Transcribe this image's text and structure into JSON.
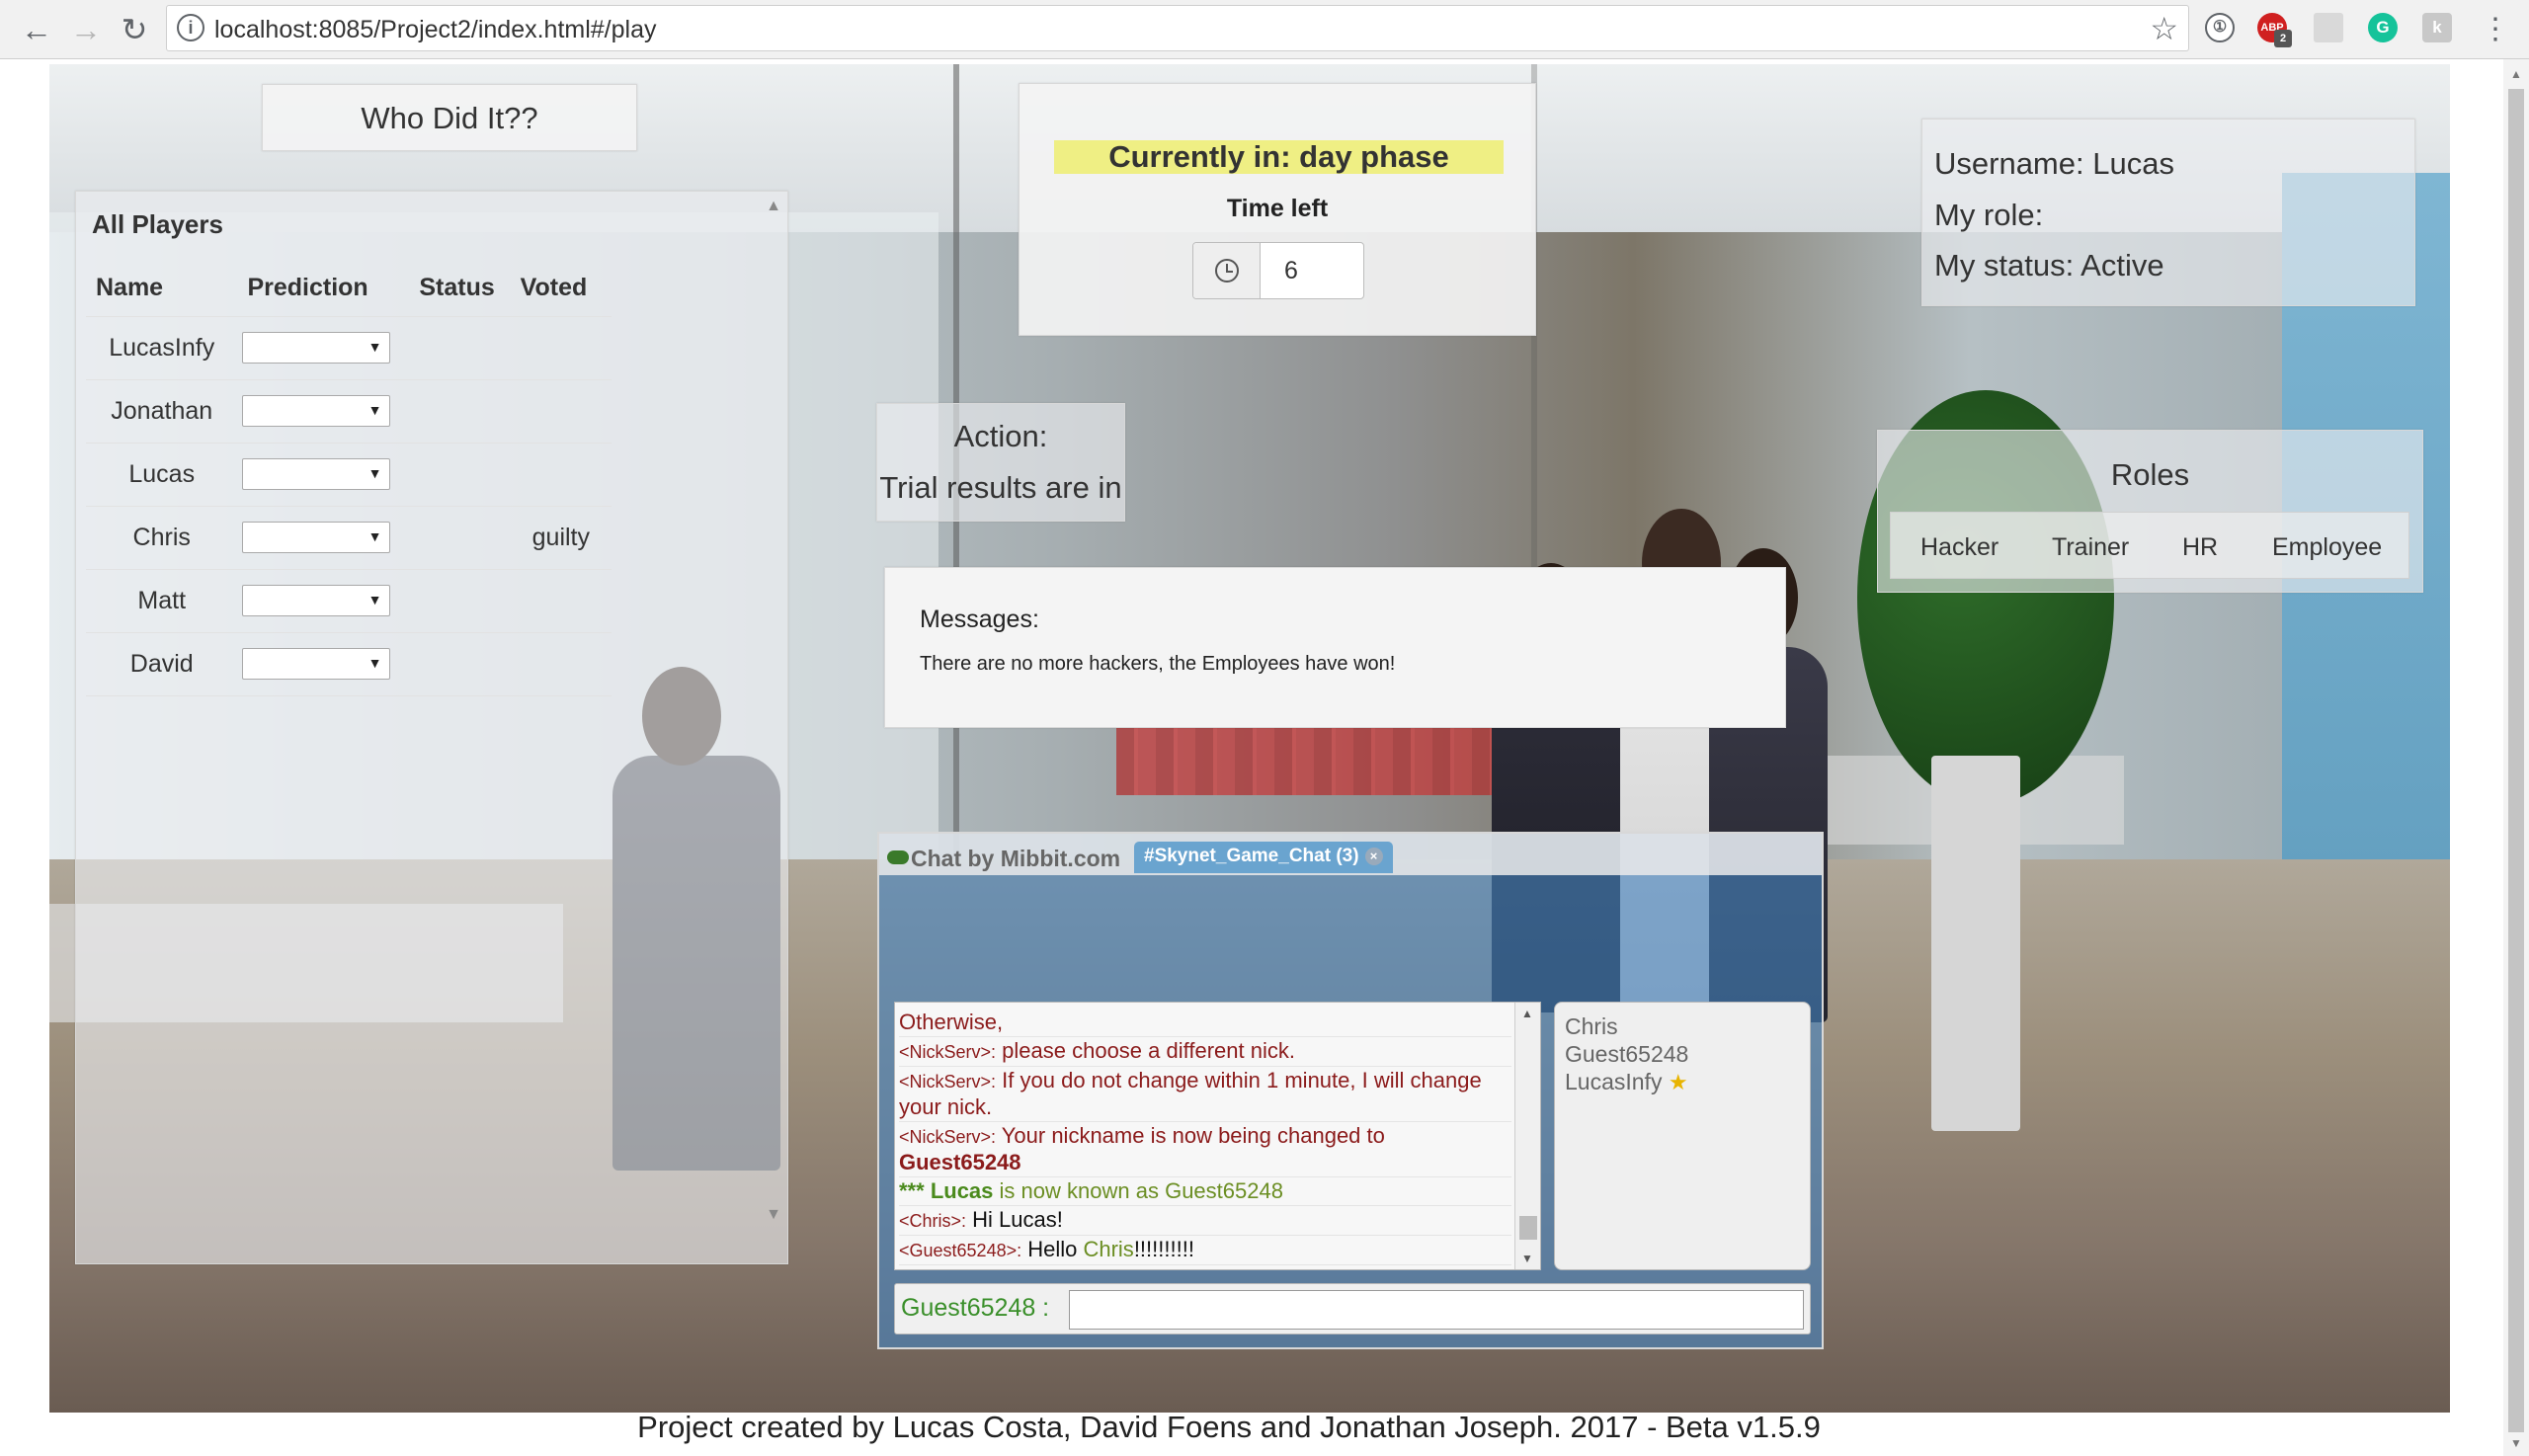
{
  "browser": {
    "url": "localhost:8085/Project2/index.html#/play",
    "ext_abp_label": "ABP",
    "ext_abp_badge": "2",
    "ext_grammarly_label": "G",
    "ext_other_label": "k"
  },
  "title": "Who Did It??",
  "players_panel": {
    "heading": "All Players",
    "columns": [
      "Name",
      "Prediction",
      "Status",
      "Voted"
    ],
    "rows": [
      {
        "name": "LucasInfy",
        "prediction": "",
        "status": "",
        "voted": ""
      },
      {
        "name": "Jonathan",
        "prediction": "",
        "status": "",
        "voted": ""
      },
      {
        "name": "Lucas",
        "prediction": "",
        "status": "",
        "voted": ""
      },
      {
        "name": "Chris",
        "prediction": "",
        "status": "",
        "voted": "guilty"
      },
      {
        "name": "Matt",
        "prediction": "",
        "status": "",
        "voted": ""
      },
      {
        "name": "David",
        "prediction": "",
        "status": "",
        "voted": ""
      }
    ]
  },
  "phase": {
    "banner": "Currently in: day phase",
    "time_left_label": "Time left",
    "time_left_value": "6"
  },
  "user": {
    "username_line": "Username: Lucas",
    "role_line": "My role:",
    "status_line": "My status: Active"
  },
  "action": {
    "label": "Action:",
    "text": "Trial results are in"
  },
  "roles": {
    "title": "Roles",
    "items": [
      "Hacker",
      "Trainer",
      "HR",
      "Employee"
    ]
  },
  "messages": {
    "label": "Messages:",
    "text": "There are no more hackers, the Employees have won!"
  },
  "chat": {
    "brand": "Chat by Mibbit.com",
    "tab": "#Skynet_Game_Chat (3)",
    "tab_close": "×",
    "log": [
      {
        "nick": "",
        "text": "Otherwise,"
      },
      {
        "nick": "<NickServ>:",
        "text": " please choose a different nick."
      },
      {
        "nick": "<NickServ>:",
        "text": " If you do not change within 1 minute, I will change your nick."
      },
      {
        "nick": "<NickServ>:",
        "text": " Your nickname is now being changed to "
      },
      {
        "nick": "",
        "text": "Guest65248"
      }
    ],
    "system_line": {
      "prefix": "***",
      "name": "Lucas",
      "middle": "is now known as",
      "new_name": "Guest65248"
    },
    "chat_lines": [
      {
        "nick": "<Chris>:",
        "text": " Hi Lucas!"
      },
      {
        "nick": "<Guest65248>:",
        "text_before": " Hello ",
        "highlight": "Chris",
        "text_after": "!!!!!!!!!!"
      }
    ],
    "users": [
      "Chris",
      "Guest65248",
      "LucasInfy"
    ],
    "input_nick_label": "Guest65248 :",
    "input_value": ""
  },
  "footer": "Project created by Lucas Costa, David Foens and Jonathan Joseph. 2017 - Beta v1.5.9",
  "colors": {
    "phase_highlight": "#efef84",
    "chat_blue": "#4682be",
    "chat_nick_green": "#3a8f2a",
    "nickserv_red": "#8b1b1b"
  }
}
